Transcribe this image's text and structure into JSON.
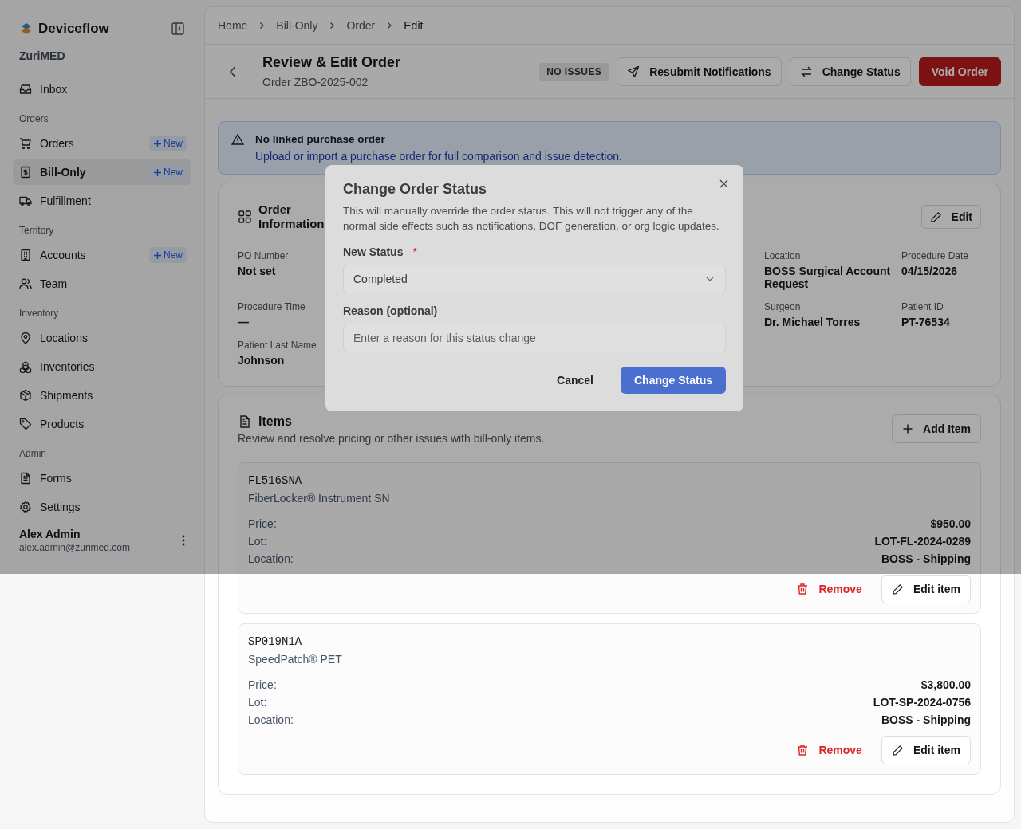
{
  "sidebar": {
    "brand": "Deviceflow",
    "org": "ZuriMED",
    "groups": [
      {
        "items": [
          {
            "label": "Inbox",
            "selected": false
          }
        ]
      },
      {
        "heading": "Orders",
        "items": [
          {
            "label": "Orders",
            "badge": "New",
            "selected": false
          },
          {
            "label": "Bill-Only",
            "badge": "New",
            "selected": true
          },
          {
            "label": "Fulfillment",
            "selected": false
          }
        ]
      },
      {
        "heading": "Territory",
        "items": [
          {
            "label": "Accounts",
            "badge": "New",
            "selected": false
          },
          {
            "label": "Team",
            "selected": false
          }
        ]
      },
      {
        "heading": "Inventory",
        "items": [
          {
            "label": "Locations",
            "selected": false
          },
          {
            "label": "Inventories",
            "selected": false
          },
          {
            "label": "Shipments",
            "selected": false
          },
          {
            "label": "Products",
            "selected": false
          }
        ]
      },
      {
        "heading": "Admin",
        "items": [
          {
            "label": "Forms",
            "selected": false
          },
          {
            "label": "Settings",
            "selected": false
          }
        ]
      }
    ],
    "user": {
      "name": "Alex Admin",
      "email": "alex.admin@zurimed.com"
    }
  },
  "breadcrumb": [
    "Home",
    "Bill-Only",
    "Order",
    "Edit"
  ],
  "header": {
    "title": "Review & Edit Order",
    "subtitle": "Order ZBO-2025-002",
    "status": "NO ISSUES",
    "buttons": [
      "Resubmit Notifications",
      "Change Status"
    ],
    "danger_button": "Void Order"
  },
  "alert": {
    "title": "No linked purchase order",
    "message": "Upload or import a purchase order for full comparison and issue detection."
  },
  "order_info": {
    "title": "Order Information",
    "edit": "Edit",
    "fields": [
      {
        "label": "PO Number",
        "value": "Not set"
      },
      {
        "label": "Location",
        "value": "BOSS Surgical Account Request"
      },
      {
        "label": "Procedure Date",
        "value": "04/15/2026"
      },
      {
        "label": "Procedure Time",
        "value": "—"
      },
      {
        "label": "Surgeon",
        "value": "Dr. Michael Torres"
      },
      {
        "label": "Patient ID",
        "value": "PT-76534"
      },
      {
        "label": "Patient Last Name",
        "value": "Johnson"
      }
    ]
  },
  "items": {
    "title": "Items",
    "subtitle": "Review and resolve pricing or other issues with bill-only items.",
    "add": "Add Item",
    "list": [
      {
        "sku": "FL516SNA",
        "name": "FiberLocker® Instrument SN",
        "rows": [
          {
            "label": "Price:",
            "value": "$950.00"
          },
          {
            "label": "Lot:",
            "value": "LOT-FL-2024-0289"
          },
          {
            "label": "Location:",
            "value": "BOSS - Shipping"
          }
        ],
        "remove": "Remove",
        "edit": "Edit item"
      },
      {
        "sku": "SP019N1A",
        "name": "SpeedPatch® PET",
        "rows": [
          {
            "label": "Price:",
            "value": "$3,800.00"
          },
          {
            "label": "Lot:",
            "value": "LOT-SP-2024-0756"
          },
          {
            "label": "Location:",
            "value": "BOSS - Shipping"
          }
        ],
        "remove": "Remove",
        "edit": "Edit item"
      }
    ]
  },
  "modal": {
    "title": "Change Order Status",
    "description": "This will manually override the order status. This will not trigger any of the normal side effects such as notifications, DOF generation, or org logic updates.",
    "status_label": "New Status",
    "required_mark": "*",
    "status_value": "Completed",
    "reason_label": "Reason (optional)",
    "reason_placeholder": "Enter a reason for this status change",
    "cancel": "Cancel",
    "confirm": "Change Status"
  }
}
